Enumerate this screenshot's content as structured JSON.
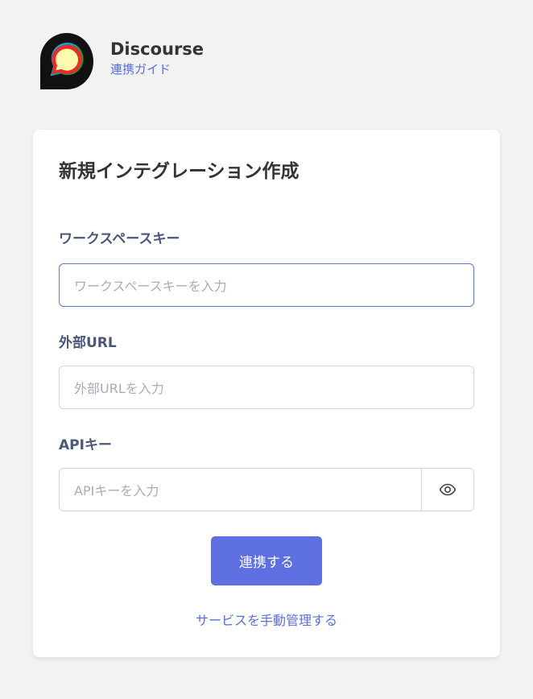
{
  "header": {
    "app_name": "Discourse",
    "guide_link": "連携ガイド",
    "logo_icon": "discourse-logo"
  },
  "form": {
    "title": "新規インテグレーション作成",
    "workspace_key": {
      "label": "ワークスペースキー",
      "placeholder": "ワークスペースキーを入力",
      "value": ""
    },
    "external_url": {
      "label": "外部URL",
      "placeholder": "外部URLを入力",
      "value": ""
    },
    "api_key": {
      "label": "APIキー",
      "placeholder": "APIキーを入力",
      "value": "",
      "toggle_icon": "eye-icon"
    },
    "submit_label": "連携する",
    "manual_link": "サービスを手動管理する"
  },
  "colors": {
    "accent": "#5e70e1",
    "link": "#5b6ee0",
    "label": "#4a5778",
    "background": "#f2f2f2",
    "focus_border": "#6272dc"
  }
}
